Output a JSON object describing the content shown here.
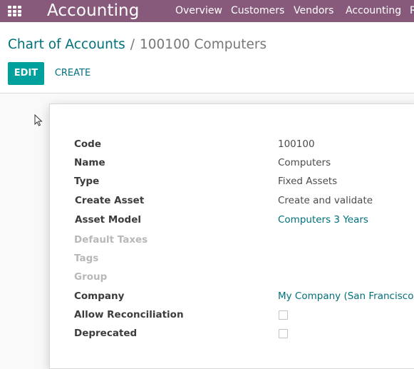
{
  "app": {
    "title": "Accounting",
    "menu": [
      "Overview",
      "Customers",
      "Vendors",
      "Accounting",
      "R"
    ]
  },
  "breadcrumb": {
    "parent": "Chart of Accounts",
    "separator": "/",
    "current": "100100 Computers"
  },
  "buttons": {
    "edit": "EDIT",
    "create": "CREATE"
  },
  "form": {
    "code": {
      "label": "Code",
      "value": "100100"
    },
    "name": {
      "label": "Name",
      "value": "Computers"
    },
    "type": {
      "label": "Type",
      "value": "Fixed Assets"
    },
    "create_asset": {
      "label": "Create Asset",
      "value": "Create and validate"
    },
    "asset_model": {
      "label": "Asset Model",
      "value": "Computers 3 Years"
    },
    "default_taxes": {
      "label": "Default Taxes",
      "value": ""
    },
    "tags": {
      "label": "Tags",
      "value": ""
    },
    "group": {
      "label": "Group",
      "value": ""
    },
    "company": {
      "label": "Company",
      "value": "My Company (San Francisco)"
    },
    "allow_reconciliation": {
      "label": "Allow Reconciliation",
      "checked": false
    },
    "deprecated": {
      "label": "Deprecated",
      "checked": false
    }
  },
  "colors": {
    "navbar": "#875a7b",
    "primary_button": "#00a09d",
    "link": "#00707b"
  }
}
